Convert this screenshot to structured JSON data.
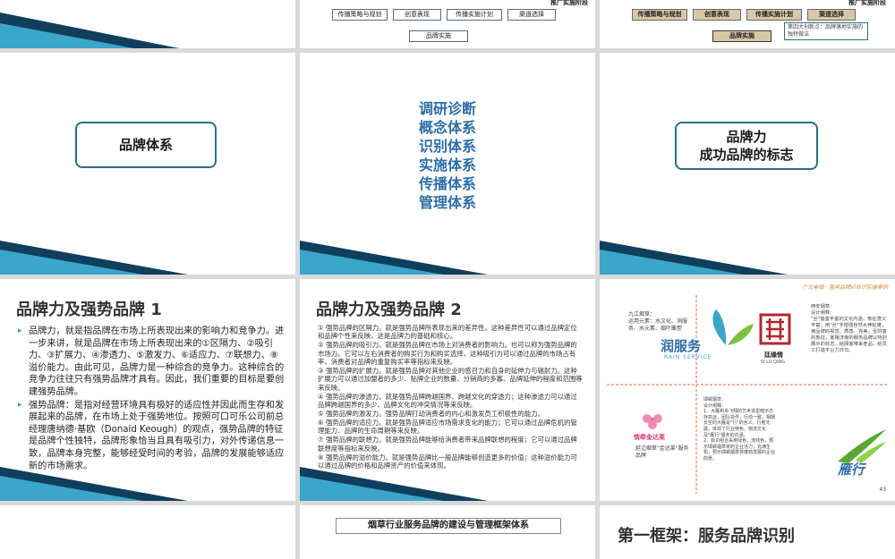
{
  "top_row": {
    "left_slide": {},
    "middle_slide": {
      "stage_label": "推广实施阶段",
      "boxes": [
        "传播策略与规划",
        "创意表现",
        "传播实施计划",
        "渠道选择"
      ],
      "bottom_box": "品牌实施"
    },
    "right_slide": {
      "stage_label": "推广实施阶段",
      "boxes": [
        "传播策略与规划",
        "创意表现",
        "传播实施计划",
        "渠道选择"
      ],
      "bottom_box": "品牌实施",
      "callout": "第四大创新点：品牌落地实施的独特做法"
    }
  },
  "row2": {
    "slide1_title": "品牌体系",
    "slide2_menu": [
      "调研诊断",
      "概念体系",
      "识别体系",
      "实施体系",
      "传播体系",
      "管理体系"
    ],
    "slide3_title_line1": "品牌力",
    "slide3_title_line2": "成功品牌的标志"
  },
  "row3": {
    "slide1": {
      "heading": "品牌力及强势品牌 1",
      "bullets": [
        "品牌力，就是指品牌在市场上所表现出来的影响力和竞争力。进一步来讲，就是品牌在市场上所表现出来的①区隔力、②吸引力、③扩展力、④渗透力、⑤激发力、⑥适应力、⑦联想力、⑧溢价能力。由此可见，品牌力是一种综合的竞争力。这种综合的竞争力往往只有强势品牌才具有。因此，我们重要的目标是要创建强势品牌。",
        "强势品牌：是指对经营环境具有极好的适应性并因此而生存和发展起来的品牌，在市场上处于强势地位。按照可口可乐公司前总经理唐纳德·基欧（Donald Keough）的观点，强势品牌的特征是品牌个性独特，品牌形象恰当且具有吸引力，对外传递信息一致，品牌本身完整，能够经受时间的考验，品牌的发展能够适应新的市场需求。"
      ]
    },
    "slide2": {
      "heading": "品牌力及强势品牌 2",
      "items": [
        "① 强势品牌的区隔力。就是强势品牌所表现出来的差异性。这种差异性可以通过品牌定位和品牌个性来反映，这是品牌力的基础和核心。",
        "② 强势品牌的吸引力。就是强势品牌在市场上对消费者的影响力。也可以称为强势品牌的市场力。它可以左右消费者的购买行为和购买选择，这种吸引力可以通过品牌的市场占有率、消费者对品牌的重复购买率等指标来反映。",
        "③ 强势品牌的扩展力。就是强势品牌对其他企业的感召力和自身的延伸力与辐射力。这种扩展力可以通过加盟者的多少、贴牌企业的数量、分销商的多寡、品牌延伸的程度和范围等来反映。",
        "④ 强势品牌的渗透力。就是强势品牌跨越国界、跨越文化的穿透力；这种渗透力可以通过品牌跨越国界的多少、品牌文化的冲突情况等来反映。",
        "⑤ 强势品牌的激发力。强势品牌打动消费者的内心和激发员工积极性的能力。",
        "⑥ 强势品牌的适应力。就是强势品牌适应市场需求变化的能力；它可以通过品牌危机的管理能力、品牌的生命周期等来反映。",
        "⑦ 强势品牌的联想力。就是强势品牌能够给消费者带来品牌联想的程度；它可以通过品牌联想度等指标来反映。",
        "⑧ 强势品牌的溢价能力。就是强势品牌比一般品牌能够创造更多的价值；这种溢价能力可以通过品牌的价格和品牌资产的价值来体现。"
      ]
    },
    "slide3": {
      "header_caption": "广北卷烟 · 服务品牌VI标识实施案例",
      "logo1_name": "润服务",
      "logo1_sub": "RAIN SERVICE",
      "logo1_caption": "九江烟草：\n运用元素：水文化、洞服务、水元素、烟叶雕塑",
      "logo2_name": "廷缘情",
      "logo2_sub": "SI LU QING",
      "logo2_caption": "西安烟草：\n设计阐释：\n\"丝\"借鉴丰富的文化内涵，象征意义丰富；用\"丝\"字增强自然水伸延度，使品牌的视觉、质感、完美，且财富的象征，客服济南的服务品牌以特别展示的标志，给顾客带来老品，给员工打造平台力日日。",
      "logo3_name": "情牵金达莱",
      "logo3_caption": "延边烟草\"金达莱\"服务品牌",
      "logo4_name": "雁行",
      "logo4_caption": "邯郸烟草：\n设计阐释：\n1、大雁和舟飞翔的艺术造型暗示志存高远，团队协作，行动一致，相期长空的大雁是\"行\"的含义，行者无疆，体现了行业特色，物流文化及\"雁行\"服务的内涵。\n2、标识组合采用绿色，流线色，预示邯郸烟草将的企业活力，充满生机，预示邯郸烟草将蓬勃发展的企业前景。",
      "page_number": "43"
    }
  },
  "bottom_row": {
    "middle_title": "烟草行业服务品牌的建设与管理框架体系",
    "right_heading": "第一框架：服务品牌识别"
  },
  "colors": {
    "accent_blue": "#2e6ea6",
    "box_border": "#2a6f88",
    "swoosh_dark": "#0f3f5c",
    "swoosh_light": "#3aa6c9"
  }
}
